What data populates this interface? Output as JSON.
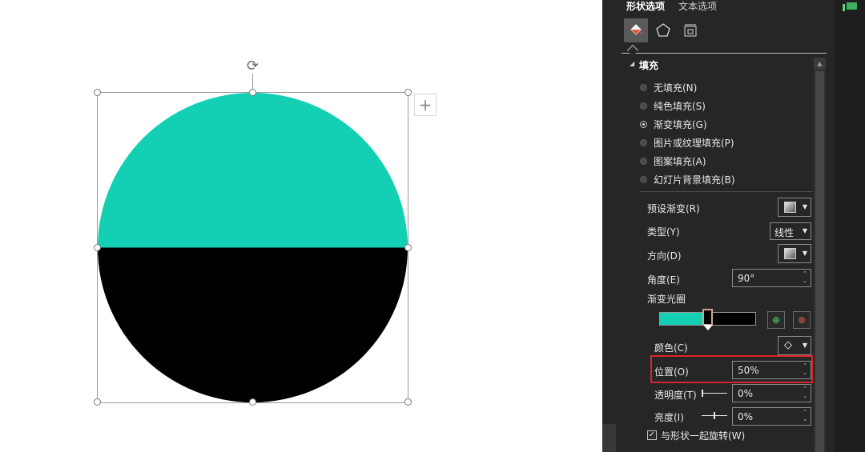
{
  "pane": {
    "tabs": {
      "shape_options": "形状选项",
      "text_options": "文本选项"
    },
    "icons": {
      "fill_line": "paint-bucket-icon",
      "effects": "pentagon-icon",
      "size_properties": "size-layout-icon"
    },
    "section_fill": "填充",
    "fill_options": [
      {
        "label": "无填充(N)",
        "checked": false
      },
      {
        "label": "纯色填充(S)",
        "checked": false
      },
      {
        "label": "渐变填充(G)",
        "checked": true
      },
      {
        "label": "图片或纹理填充(P)",
        "checked": false
      },
      {
        "label": "图案填充(A)",
        "checked": false
      },
      {
        "label": "幻灯片背景填充(B)",
        "checked": false
      }
    ],
    "preset_gradient_label": "预设渐变(R)",
    "type_label": "类型(Y)",
    "type_value": "线性",
    "direction_label": "方向(D)",
    "angle_label": "角度(E)",
    "angle_value": "90°",
    "gradient_stops_label": "渐变光圈",
    "color_label": "颜色(C)",
    "position_label": "位置(O)",
    "position_value": "50%",
    "transparency_label": "透明度(T)",
    "transparency_value": "0%",
    "brightness_label": "亮度(I)",
    "brightness_value": "0%",
    "rotate_with_shape_label": "与形状一起旋转(W)",
    "rotate_with_shape_checked": true
  },
  "canvas": {
    "shape_fill_colors": {
      "top": "#13cfb4",
      "bottom": "#000000"
    },
    "gradient_stop_position": 0.5
  },
  "colors": {
    "accent_teal": "#13cfb4",
    "pane_bg": "#262626",
    "highlight_red": "#d9252a"
  }
}
